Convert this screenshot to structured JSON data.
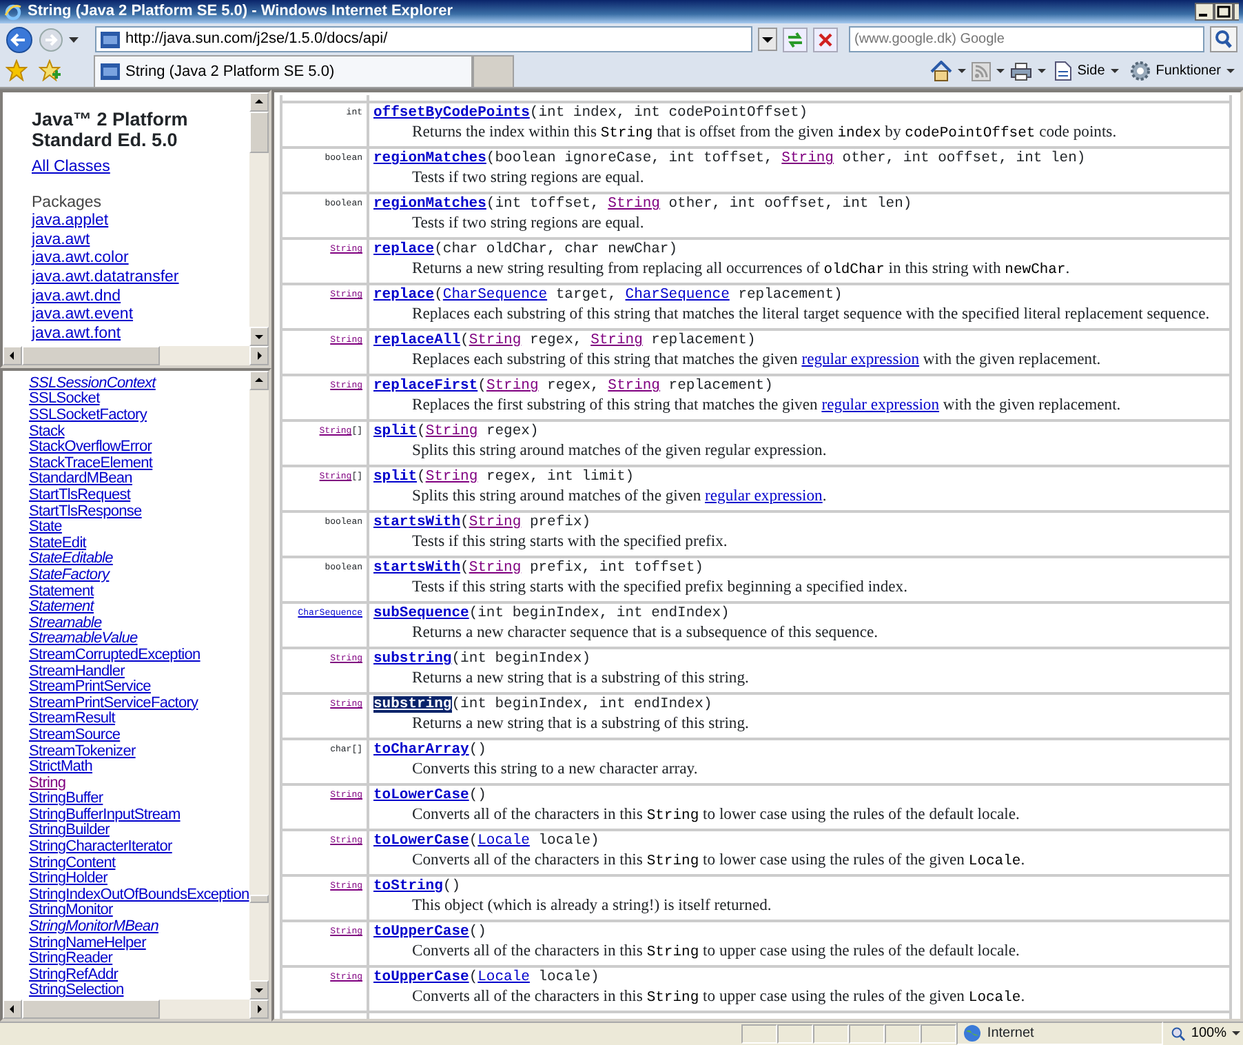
{
  "window": {
    "title": "String (Java 2 Platform SE 5.0) - Windows Internet Explorer"
  },
  "address_bar": {
    "url": "http://java.sun.com/j2se/1.5.0/docs/api/"
  },
  "search": {
    "placeholder": "(www.google.dk) Google"
  },
  "tabs": [
    {
      "label": "String (Java 2 Platform SE 5.0)",
      "selected": true
    }
  ],
  "command_bar": [
    {
      "kind": "home"
    },
    {
      "kind": "feeds"
    },
    {
      "kind": "print"
    },
    {
      "kind": "page",
      "label": "Side"
    },
    {
      "kind": "tools",
      "label": "Funktioner"
    }
  ],
  "package_frame": {
    "title": "Java™ 2 Platform Standard Ed. 5.0",
    "all_classes": "All Classes",
    "heading": "Packages",
    "packages": [
      "java.applet",
      "java.awt",
      "java.awt.color",
      "java.awt.datatransfer",
      "java.awt.dnd",
      "java.awt.event",
      "java.awt.font"
    ]
  },
  "class_frame": {
    "classes": [
      {
        "label": "SSLSessionContext",
        "italic": true,
        "visited": false
      },
      {
        "label": "SSLSocket",
        "italic": false,
        "visited": false
      },
      {
        "label": "SSLSocketFactory",
        "italic": false,
        "visited": false
      },
      {
        "label": "Stack",
        "italic": false,
        "visited": false
      },
      {
        "label": "StackOverflowError",
        "italic": false,
        "visited": false
      },
      {
        "label": "StackTraceElement",
        "italic": false,
        "visited": false
      },
      {
        "label": "StandardMBean",
        "italic": false,
        "visited": false
      },
      {
        "label": "StartTlsRequest",
        "italic": false,
        "visited": false
      },
      {
        "label": "StartTlsResponse",
        "italic": false,
        "visited": false
      },
      {
        "label": "State",
        "italic": false,
        "visited": false
      },
      {
        "label": "StateEdit",
        "italic": false,
        "visited": false
      },
      {
        "label": "StateEditable",
        "italic": true,
        "visited": false
      },
      {
        "label": "StateFactory",
        "italic": true,
        "visited": false
      },
      {
        "label": "Statement",
        "italic": false,
        "visited": false
      },
      {
        "label": "Statement",
        "italic": true,
        "visited": false
      },
      {
        "label": "Streamable",
        "italic": true,
        "visited": false
      },
      {
        "label": "StreamableValue",
        "italic": true,
        "visited": false
      },
      {
        "label": "StreamCorruptedException",
        "italic": false,
        "visited": false
      },
      {
        "label": "StreamHandler",
        "italic": false,
        "visited": false
      },
      {
        "label": "StreamPrintService",
        "italic": false,
        "visited": false
      },
      {
        "label": "StreamPrintServiceFactory",
        "italic": false,
        "visited": false
      },
      {
        "label": "StreamResult",
        "italic": false,
        "visited": false
      },
      {
        "label": "StreamSource",
        "italic": false,
        "visited": false
      },
      {
        "label": "StreamTokenizer",
        "italic": false,
        "visited": false
      },
      {
        "label": "StrictMath",
        "italic": false,
        "visited": false
      },
      {
        "label": "String",
        "italic": false,
        "visited": true
      },
      {
        "label": "StringBuffer",
        "italic": false,
        "visited": false
      },
      {
        "label": "StringBufferInputStream",
        "italic": false,
        "visited": false
      },
      {
        "label": "StringBuilder",
        "italic": false,
        "visited": false
      },
      {
        "label": "StringCharacterIterator",
        "italic": false,
        "visited": false
      },
      {
        "label": "StringContent",
        "italic": false,
        "visited": false
      },
      {
        "label": "StringHolder",
        "italic": false,
        "visited": false
      },
      {
        "label": "StringIndexOutOfBoundsException",
        "italic": false,
        "visited": false
      },
      {
        "label": "StringMonitor",
        "italic": false,
        "visited": false
      },
      {
        "label": "StringMonitorMBean",
        "italic": true,
        "visited": false
      },
      {
        "label": "StringNameHelper",
        "italic": false,
        "visited": false
      },
      {
        "label": "StringReader",
        "italic": false,
        "visited": false
      },
      {
        "label": "StringRefAddr",
        "italic": false,
        "visited": false
      },
      {
        "label": "StringSelection",
        "italic": false,
        "visited": false
      }
    ]
  },
  "methods": [
    {
      "return_type": [
        {
          "kind": "text",
          "text": "int"
        }
      ],
      "signature": [
        {
          "kind": "method",
          "text": "offsetByCodePoints",
          "highlighted": false
        },
        {
          "kind": "text",
          "text": "(int index, int codePointOffset)"
        }
      ],
      "description": [
        {
          "kind": "text",
          "text": "Returns the index within this "
        },
        {
          "kind": "code",
          "text": "String"
        },
        {
          "kind": "text",
          "text": " that is offset from the given "
        },
        {
          "kind": "code",
          "text": "index"
        },
        {
          "kind": "text",
          "text": " by "
        },
        {
          "kind": "code",
          "text": "codePointOffset"
        },
        {
          "kind": "text",
          "text": " code points."
        }
      ]
    },
    {
      "return_type": [
        {
          "kind": "text",
          "text": "boolean"
        }
      ],
      "signature": [
        {
          "kind": "method",
          "text": "regionMatches",
          "highlighted": false
        },
        {
          "kind": "text",
          "text": "(boolean ignoreCase, int toffset, "
        },
        {
          "kind": "link",
          "text": "String",
          "visited": true
        },
        {
          "kind": "text",
          "text": " other, int ooffset, int len)"
        }
      ],
      "description": [
        {
          "kind": "text",
          "text": "Tests if two string regions are equal."
        }
      ]
    },
    {
      "return_type": [
        {
          "kind": "text",
          "text": "boolean"
        }
      ],
      "signature": [
        {
          "kind": "method",
          "text": "regionMatches",
          "highlighted": false
        },
        {
          "kind": "text",
          "text": "(int toffset, "
        },
        {
          "kind": "link",
          "text": "String",
          "visited": true
        },
        {
          "kind": "text",
          "text": " other, int ooffset, int len)"
        }
      ],
      "description": [
        {
          "kind": "text",
          "text": "Tests if two string regions are equal."
        }
      ]
    },
    {
      "return_type": [
        {
          "kind": "link",
          "text": "String",
          "visited": true
        }
      ],
      "signature": [
        {
          "kind": "method",
          "text": "replace",
          "highlighted": false
        },
        {
          "kind": "text",
          "text": "(char oldChar, char newChar)"
        }
      ],
      "description": [
        {
          "kind": "text",
          "text": "Returns a new string resulting from replacing all occurrences of "
        },
        {
          "kind": "code",
          "text": "oldChar"
        },
        {
          "kind": "text",
          "text": " in this string with "
        },
        {
          "kind": "code",
          "text": "newChar"
        },
        {
          "kind": "text",
          "text": "."
        }
      ]
    },
    {
      "return_type": [
        {
          "kind": "link",
          "text": "String",
          "visited": true
        }
      ],
      "signature": [
        {
          "kind": "method",
          "text": "replace",
          "highlighted": false
        },
        {
          "kind": "text",
          "text": "("
        },
        {
          "kind": "link",
          "text": "CharSequence",
          "visited": false
        },
        {
          "kind": "text",
          "text": " target, "
        },
        {
          "kind": "link",
          "text": "CharSequence",
          "visited": false
        },
        {
          "kind": "text",
          "text": " replacement)"
        }
      ],
      "description": [
        {
          "kind": "text",
          "text": "Replaces each substring of this string that matches the literal target sequence with the specified literal replacement sequence."
        }
      ]
    },
    {
      "return_type": [
        {
          "kind": "link",
          "text": "String",
          "visited": true
        }
      ],
      "signature": [
        {
          "kind": "method",
          "text": "replaceAll",
          "highlighted": false
        },
        {
          "kind": "text",
          "text": "("
        },
        {
          "kind": "link",
          "text": "String",
          "visited": true
        },
        {
          "kind": "text",
          "text": " regex, "
        },
        {
          "kind": "link",
          "text": "String",
          "visited": true
        },
        {
          "kind": "text",
          "text": " replacement)"
        }
      ],
      "description": [
        {
          "kind": "text",
          "text": "Replaces each substring of this string that matches the given "
        },
        {
          "kind": "link",
          "text": "regular expression",
          "visited": false
        },
        {
          "kind": "text",
          "text": " with the given replacement."
        }
      ]
    },
    {
      "return_type": [
        {
          "kind": "link",
          "text": "String",
          "visited": true
        }
      ],
      "signature": [
        {
          "kind": "method",
          "text": "replaceFirst",
          "highlighted": false
        },
        {
          "kind": "text",
          "text": "("
        },
        {
          "kind": "link",
          "text": "String",
          "visited": true
        },
        {
          "kind": "text",
          "text": " regex, "
        },
        {
          "kind": "link",
          "text": "String",
          "visited": true
        },
        {
          "kind": "text",
          "text": " replacement)"
        }
      ],
      "description": [
        {
          "kind": "text",
          "text": "Replaces the first substring of this string that matches the given "
        },
        {
          "kind": "link",
          "text": "regular expression",
          "visited": false
        },
        {
          "kind": "text",
          "text": " with the given replacement."
        }
      ]
    },
    {
      "return_type": [
        {
          "kind": "link",
          "text": "String",
          "visited": true
        },
        {
          "kind": "text",
          "text": "[]"
        }
      ],
      "signature": [
        {
          "kind": "method",
          "text": "split",
          "highlighted": false
        },
        {
          "kind": "text",
          "text": "("
        },
        {
          "kind": "link",
          "text": "String",
          "visited": true
        },
        {
          "kind": "text",
          "text": " regex)"
        }
      ],
      "description": [
        {
          "kind": "text",
          "text": "Splits this string around matches of the given regular expression."
        }
      ]
    },
    {
      "return_type": [
        {
          "kind": "link",
          "text": "String",
          "visited": true
        },
        {
          "kind": "text",
          "text": "[]"
        }
      ],
      "signature": [
        {
          "kind": "method",
          "text": "split",
          "highlighted": false
        },
        {
          "kind": "text",
          "text": "("
        },
        {
          "kind": "link",
          "text": "String",
          "visited": true
        },
        {
          "kind": "text",
          "text": " regex, int limit)"
        }
      ],
      "description": [
        {
          "kind": "text",
          "text": "Splits this string around matches of the given "
        },
        {
          "kind": "link",
          "text": "regular expression",
          "visited": false
        },
        {
          "kind": "text",
          "text": "."
        }
      ]
    },
    {
      "return_type": [
        {
          "kind": "text",
          "text": "boolean"
        }
      ],
      "signature": [
        {
          "kind": "method",
          "text": "startsWith",
          "highlighted": false
        },
        {
          "kind": "text",
          "text": "("
        },
        {
          "kind": "link",
          "text": "String",
          "visited": true
        },
        {
          "kind": "text",
          "text": " prefix)"
        }
      ],
      "description": [
        {
          "kind": "text",
          "text": "Tests if this string starts with the specified prefix."
        }
      ]
    },
    {
      "return_type": [
        {
          "kind": "text",
          "text": "boolean"
        }
      ],
      "signature": [
        {
          "kind": "method",
          "text": "startsWith",
          "highlighted": false
        },
        {
          "kind": "text",
          "text": "("
        },
        {
          "kind": "link",
          "text": "String",
          "visited": true
        },
        {
          "kind": "text",
          "text": " prefix, int toffset)"
        }
      ],
      "description": [
        {
          "kind": "text",
          "text": "Tests if this string starts with the specified prefix beginning a specified index."
        }
      ]
    },
    {
      "return_type": [
        {
          "kind": "link",
          "text": "CharSequence",
          "visited": false
        }
      ],
      "signature": [
        {
          "kind": "method",
          "text": "subSequence",
          "highlighted": false
        },
        {
          "kind": "text",
          "text": "(int beginIndex, int endIndex)"
        }
      ],
      "description": [
        {
          "kind": "text",
          "text": "Returns a new character sequence that is a subsequence of this sequence."
        }
      ]
    },
    {
      "return_type": [
        {
          "kind": "link",
          "text": "String",
          "visited": true
        }
      ],
      "signature": [
        {
          "kind": "method",
          "text": "substring",
          "highlighted": false
        },
        {
          "kind": "text",
          "text": "(int beginIndex)"
        }
      ],
      "description": [
        {
          "kind": "text",
          "text": "Returns a new string that is a substring of this string."
        }
      ]
    },
    {
      "return_type": [
        {
          "kind": "link",
          "text": "String",
          "visited": true
        }
      ],
      "signature": [
        {
          "kind": "method",
          "text": "substring",
          "highlighted": true
        },
        {
          "kind": "text",
          "text": "(int beginIndex, int endIndex)"
        }
      ],
      "description": [
        {
          "kind": "text",
          "text": "Returns a new string that is a substring of this string."
        }
      ]
    },
    {
      "return_type": [
        {
          "kind": "text",
          "text": "char[]"
        }
      ],
      "signature": [
        {
          "kind": "method",
          "text": "toCharArray",
          "highlighted": false
        },
        {
          "kind": "text",
          "text": "()"
        }
      ],
      "description": [
        {
          "kind": "text",
          "text": "Converts this string to a new character array."
        }
      ]
    },
    {
      "return_type": [
        {
          "kind": "link",
          "text": "String",
          "visited": true
        }
      ],
      "signature": [
        {
          "kind": "method",
          "text": "toLowerCase",
          "highlighted": false
        },
        {
          "kind": "text",
          "text": "()"
        }
      ],
      "description": [
        {
          "kind": "text",
          "text": "Converts all of the characters in this "
        },
        {
          "kind": "code",
          "text": "String"
        },
        {
          "kind": "text",
          "text": " to lower case using the rules of the default locale."
        }
      ]
    },
    {
      "return_type": [
        {
          "kind": "link",
          "text": "String",
          "visited": true
        }
      ],
      "signature": [
        {
          "kind": "method",
          "text": "toLowerCase",
          "highlighted": false
        },
        {
          "kind": "text",
          "text": "("
        },
        {
          "kind": "link",
          "text": "Locale",
          "visited": false
        },
        {
          "kind": "text",
          "text": " locale)"
        }
      ],
      "description": [
        {
          "kind": "text",
          "text": "Converts all of the characters in this "
        },
        {
          "kind": "code",
          "text": "String"
        },
        {
          "kind": "text",
          "text": " to lower case using the rules of the given "
        },
        {
          "kind": "code",
          "text": "Locale"
        },
        {
          "kind": "text",
          "text": "."
        }
      ]
    },
    {
      "return_type": [
        {
          "kind": "link",
          "text": "String",
          "visited": true
        }
      ],
      "signature": [
        {
          "kind": "method",
          "text": "toString",
          "highlighted": false
        },
        {
          "kind": "text",
          "text": "()"
        }
      ],
      "description": [
        {
          "kind": "text",
          "text": "This object (which is already a string!) is itself returned."
        }
      ]
    },
    {
      "return_type": [
        {
          "kind": "link",
          "text": "String",
          "visited": true
        }
      ],
      "signature": [
        {
          "kind": "method",
          "text": "toUpperCase",
          "highlighted": false
        },
        {
          "kind": "text",
          "text": "()"
        }
      ],
      "description": [
        {
          "kind": "text",
          "text": "Converts all of the characters in this "
        },
        {
          "kind": "code",
          "text": "String"
        },
        {
          "kind": "text",
          "text": " to upper case using the rules of the default locale."
        }
      ]
    },
    {
      "return_type": [
        {
          "kind": "link",
          "text": "String",
          "visited": true
        }
      ],
      "signature": [
        {
          "kind": "method",
          "text": "toUpperCase",
          "highlighted": false
        },
        {
          "kind": "text",
          "text": "("
        },
        {
          "kind": "link",
          "text": "Locale",
          "visited": false
        },
        {
          "kind": "text",
          "text": " locale)"
        }
      ],
      "description": [
        {
          "kind": "text",
          "text": "Converts all of the characters in this "
        },
        {
          "kind": "code",
          "text": "String"
        },
        {
          "kind": "text",
          "text": " to upper case using the rules of the given "
        },
        {
          "kind": "code",
          "text": "Locale"
        },
        {
          "kind": "text",
          "text": "."
        }
      ]
    }
  ],
  "status_bar": {
    "zone": "Internet",
    "zoom": "100%"
  }
}
